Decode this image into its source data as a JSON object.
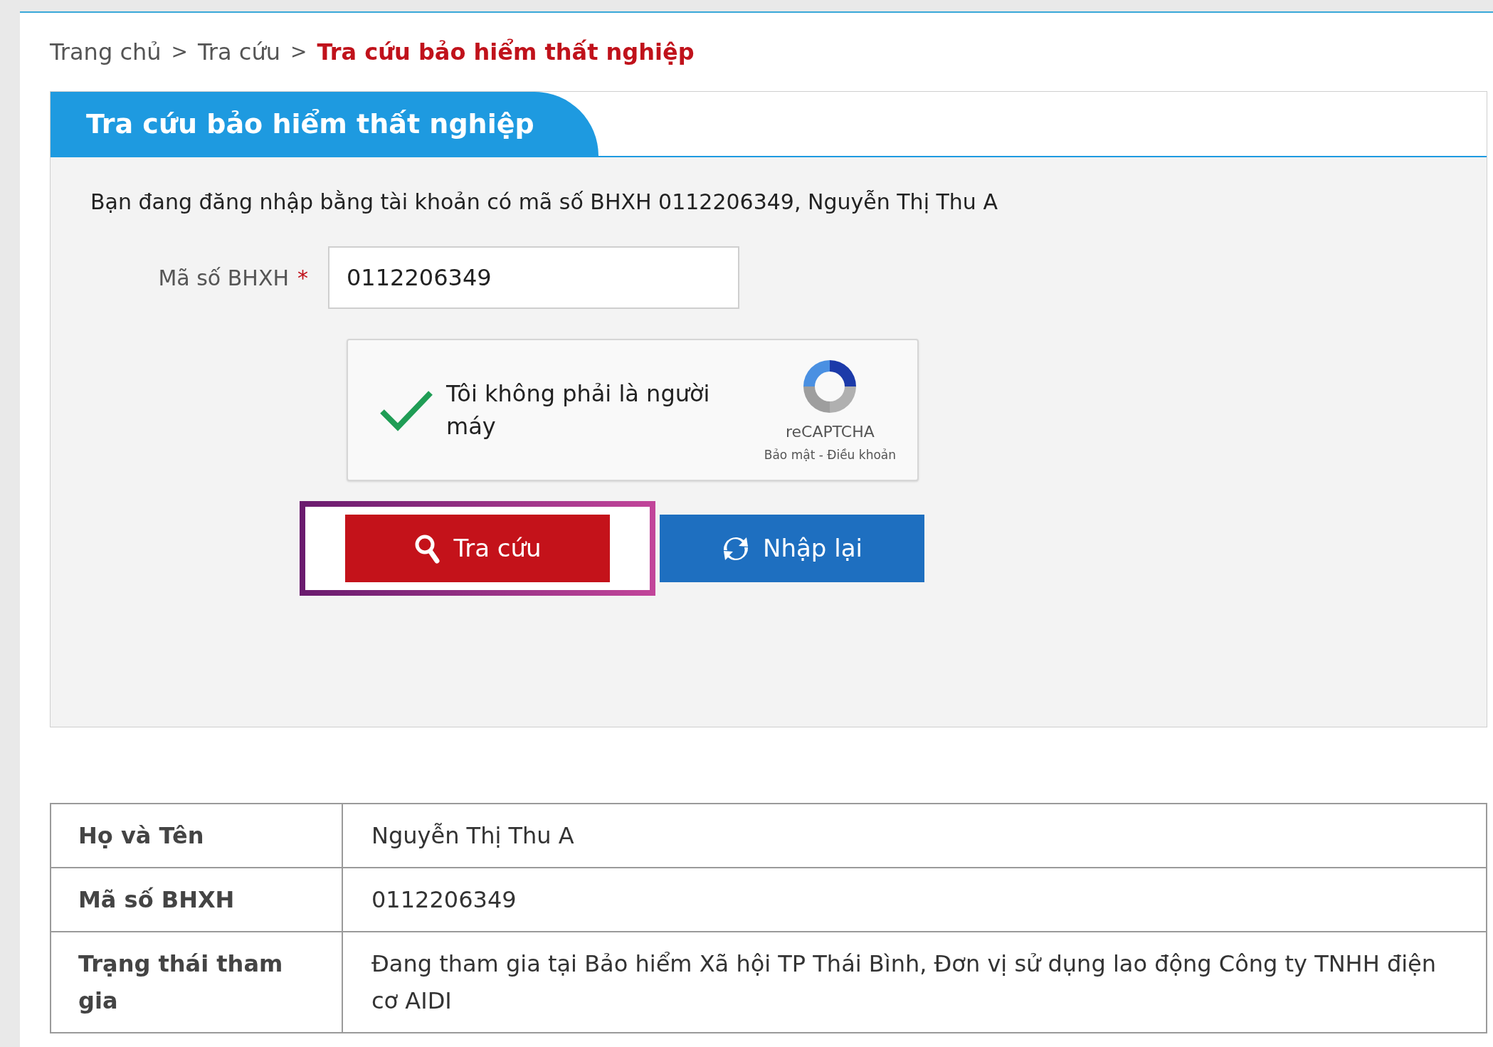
{
  "breadcrumb": [
    {
      "label": "Trang chủ",
      "separator": ">",
      "current": false
    },
    {
      "label": "Tra cứu",
      "separator": ">",
      "current": false
    },
    {
      "label": "Tra cứu bảo hiểm thất nghiệp",
      "current": true
    }
  ],
  "panel": {
    "title": "Tra cứu bảo hiểm thất nghiệp",
    "notice": "Bạn đang đăng nhập bằng tài khoản có mã số BHXH 0112206349, Nguyễn Thị Thu A",
    "field": {
      "label": "Mã số BHXH",
      "required_mark": "*",
      "value": "0112206349"
    },
    "captcha": {
      "label": "Tôi không phải là người máy",
      "checked": true,
      "brand": "reCAPTCHA",
      "links": "Bảo mật - Điều khoản"
    },
    "buttons": [
      {
        "label": "Tra cứu",
        "kind": "search",
        "highlighted": true
      },
      {
        "label": "Nhập lại",
        "kind": "reset",
        "highlighted": false
      }
    ]
  },
  "table": {
    "rows": [
      {
        "label": "Họ và Tên",
        "value": "Nguyễn Thị Thu A"
      },
      {
        "label": "Mã số BHXH",
        "value": "0112206349"
      },
      {
        "label": "Trạng thái tham gia",
        "value": "Đang tham gia tại Bảo hiểm Xã hội TP Thái Bình, Đơn vị sử dụng lao động Công ty TNHH điện cơ AIDI"
      }
    ]
  }
}
